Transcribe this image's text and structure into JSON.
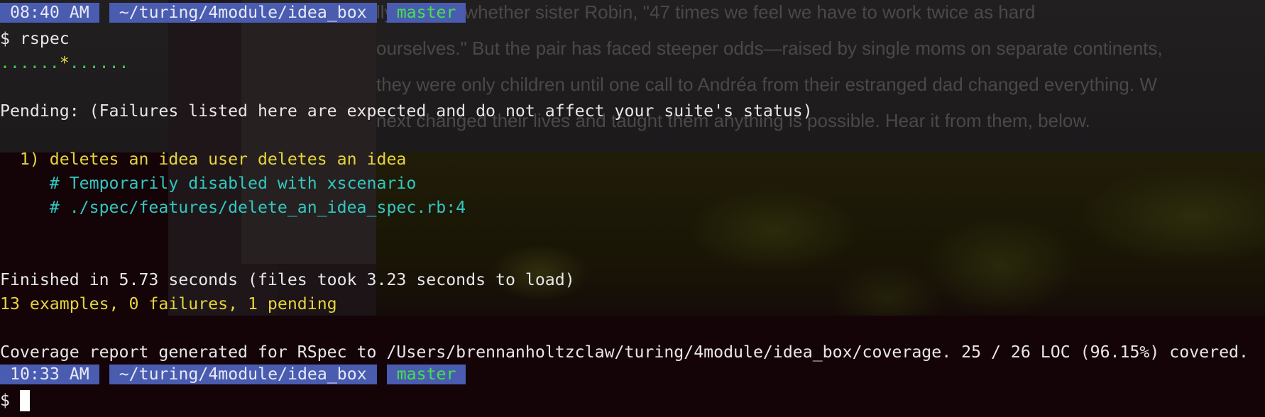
{
  "background": {
    "article_lines": [
      "lly in 2003 whether sister Robin, \"47 times we feel we have to work twice as hard",
      "ourselves.\" But the pair has faced steeper odds—raised by single moms on separate continents,",
      "they were only children until one call to Andréa from their estranged dad changed everything. W",
      "next changed their lives and taught them anything is possible. Hear it from them, below."
    ]
  },
  "prompt1": {
    "time": "08:40 AM",
    "path": "~/turing/4module/idea_box",
    "branch": "master",
    "symbol": "$",
    "command": "rspec"
  },
  "progress": {
    "dots_before": "......",
    "pending_mark": "*",
    "dots_after": "......"
  },
  "pending": {
    "header": "Pending: (Failures listed here are expected and do not affect your suite's status)",
    "item_title": "  1) deletes an idea user deletes an idea",
    "item_reason": "     # Temporarily disabled with xscenario",
    "item_location": "     # ./spec/features/delete_an_idea_spec.rb:4"
  },
  "summary": {
    "finished": "Finished in 5.73 seconds (files took 3.23 seconds to load)",
    "counts": "13 examples, 0 failures, 1 pending"
  },
  "coverage": {
    "text": "Coverage report generated for RSpec to /Users/brennanholtzclaw/turing/4module/idea_box/coverage. 25 / 26 LOC (96.15%) covered."
  },
  "prompt2": {
    "time": "10:33 AM",
    "path": "~/turing/4module/idea_box",
    "branch": "master",
    "symbol": "$"
  },
  "colors": {
    "prompt_segment_bg": "#4a5cb0",
    "branch_text": "#46e04c",
    "pass_dots": "#3fca55",
    "pending": "#e5d43d",
    "comment": "#32c7c0",
    "terminal_bg": "#140408"
  }
}
